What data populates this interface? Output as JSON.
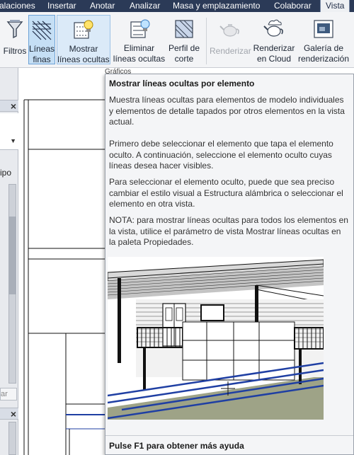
{
  "ribbon_tabs": [
    "alaciones",
    "Insertar",
    "Anotar",
    "Analizar",
    "Masa y emplazamiento",
    "Colaborar",
    "Vista"
  ],
  "ribbon_buttons": {
    "filtros": "Filtros",
    "lineas_finas": [
      "Líneas",
      "finas"
    ],
    "mostrar_lineas_ocultas": [
      "Mostrar",
      "líneas ocultas"
    ],
    "eliminar_lineas_ocultas": [
      "Eliminar",
      "líneas ocultas"
    ],
    "perfil_de_corte": [
      "Perfil de",
      "corte"
    ],
    "renderizar": "Renderizar",
    "renderizar_cloud": [
      "Renderizar",
      "en Cloud"
    ],
    "galeria_renderizacion": [
      "Galería de",
      "renderización"
    ]
  },
  "panel_title": "Gráficos",
  "left_palette": {
    "close_glyph": "×",
    "partial_label": "ipo",
    "partial_button": "ar"
  },
  "tooltip": {
    "title": "Mostrar líneas ocultas por elemento",
    "p1": "Muestra líneas ocultas para elementos de modelo individuales y elementos de detalle tapados por otros elementos en la vista actual.",
    "p2": "Primero debe seleccionar el elemento que tapa el elemento oculto. A continuación, seleccione el elemento oculto cuyas líneas desea hacer visibles.",
    "p3": "Para seleccionar el elemento oculto, puede que sea preciso cambiar el estilo visual a Estructura alámbrica o seleccionar el elemento en otra vista.",
    "p4": "NOTA: para mostrar líneas ocultas para todos los elementos en la vista, utilice el parámetro de vista Mostrar líneas ocultas en la paleta Propiedades.",
    "footer": "Pulse F1 para obtener más ayuda"
  },
  "colors": {
    "tab_bar": "#2b3a57",
    "selected_button": "#c5dff5",
    "hidden_line_blue": "#1f3fa3"
  }
}
